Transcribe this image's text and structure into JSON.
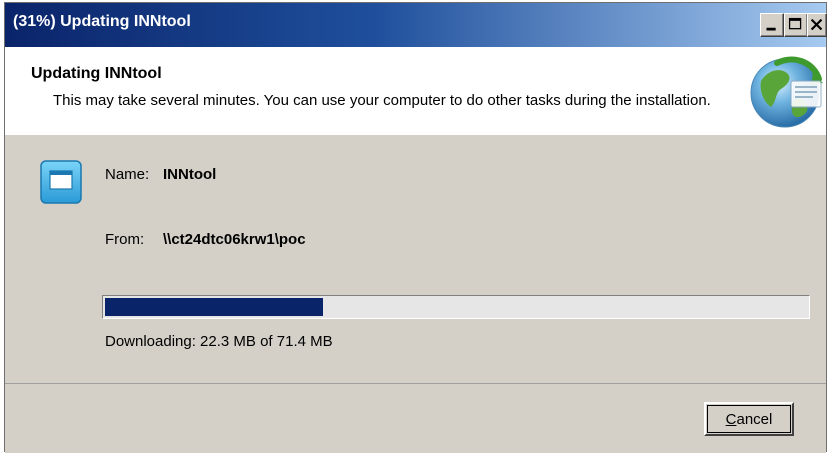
{
  "window": {
    "title": "(31%) Updating INNtool",
    "controls": [
      "minimize-icon",
      "maximize-icon",
      "close-icon"
    ]
  },
  "header": {
    "title": "Updating INNtool",
    "description": "This may take several minutes. You can use your computer to do other tasks during the installation.",
    "logo_icon": "globe-update-icon"
  },
  "app": {
    "icon": "application-window-icon",
    "name_label": "Name:",
    "name_value": "INNtool",
    "from_label": "From:",
    "from_value": "\\\\ct24dtc06krw1\\poc"
  },
  "progress": {
    "percent": 31,
    "text": "Downloading: 22.3 MB of 71.4 MB"
  },
  "footer": {
    "cancel_mnemonic": "C",
    "cancel_rest": "ancel"
  },
  "colors": {
    "title_gradient_start": "#0a246a",
    "title_gradient_end": "#a6caf0",
    "progress_fill": "#0a246a",
    "dialog_face": "#d4d0c8"
  }
}
